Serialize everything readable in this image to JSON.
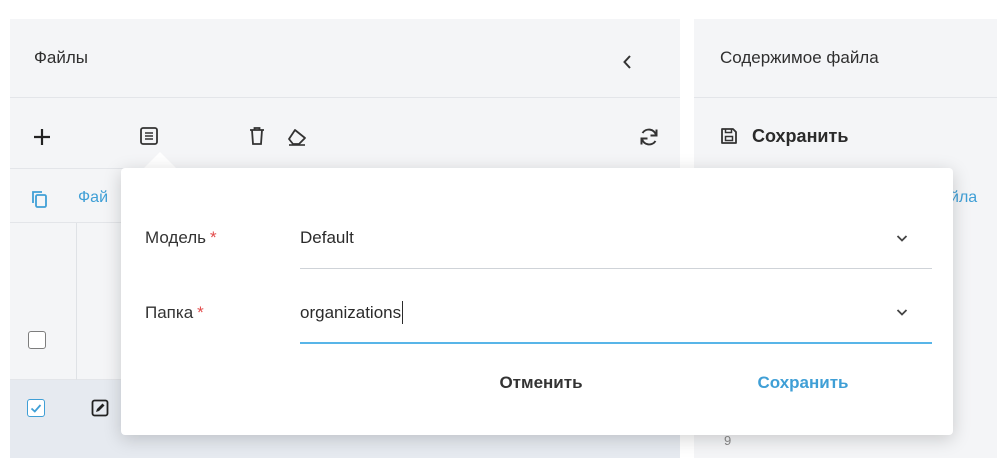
{
  "files_panel": {
    "title": "Файлы",
    "column_label": "Фай"
  },
  "content_panel": {
    "title": "Содержимое файла",
    "save_label": "Сохранить",
    "column_label_fragment": "йла",
    "line_number": "9"
  },
  "popover": {
    "model": {
      "label": "Модель",
      "required_mark": "*",
      "value": "Default"
    },
    "folder": {
      "label": "Папка",
      "required_mark": "*",
      "value": "organizations"
    },
    "cancel_label": "Отменить",
    "save_label": "Сохранить"
  },
  "icons": {
    "collapse": "chevron-left-icon",
    "add": "plus-icon",
    "list": "list-icon",
    "delete": "trash-icon",
    "eraser": "eraser-icon",
    "refresh": "refresh-icon",
    "copy": "copy-icon",
    "edit": "edit-icon",
    "save": "floppy-disk-icon",
    "dropdown": "chevron-down-icon"
  },
  "colors": {
    "accent": "#3f9fd6",
    "required": "#e24a4a",
    "panel_background": "#f4f5f7",
    "selected_row": "#e6eaf0"
  }
}
